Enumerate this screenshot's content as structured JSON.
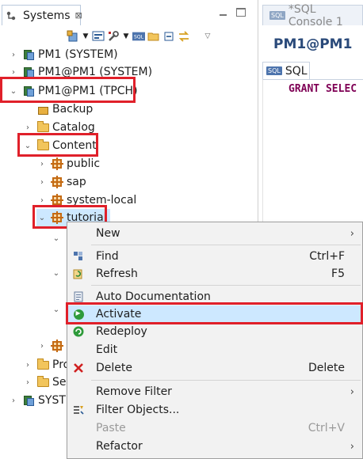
{
  "left_panel": {
    "tab_label": "Systems",
    "tab_close": "⊠"
  },
  "tree": [
    {
      "label": "PM1 (SYSTEM)",
      "twisty": "›",
      "icon": "database-icon"
    },
    {
      "label": "PM1@PM1 (SYSTEM)",
      "twisty": "›",
      "icon": "database-icon"
    },
    {
      "label": "PM1@PM1 (TPCH)",
      "twisty": "⌄",
      "icon": "database-icon"
    },
    {
      "label": "Backup",
      "twisty": "",
      "icon": "backup-icon"
    },
    {
      "label": "Catalog",
      "twisty": "›",
      "icon": "folder-icon"
    },
    {
      "label": "Content",
      "twisty": "⌄",
      "icon": "folder-icon"
    },
    {
      "label": "public",
      "twisty": "›",
      "icon": "package-icon"
    },
    {
      "label": "sap",
      "twisty": "›",
      "icon": "package-icon"
    },
    {
      "label": "system-local",
      "twisty": "›",
      "icon": "package-icon"
    },
    {
      "label": "tutorial",
      "twisty": "⌄",
      "icon": "package-icon"
    },
    {
      "label": "Pro",
      "twisty": "›",
      "icon": "folder-icon"
    },
    {
      "label": "Sec",
      "twisty": "›",
      "icon": "folder-icon"
    },
    {
      "label": "SYSTE",
      "twisty": "›",
      "icon": "database-icon"
    }
  ],
  "right_panel": {
    "editor_tab": "*SQL Console 1",
    "sql_badge": "SQL",
    "connection_title": "PM1@PM1",
    "subtab_label": "SQL",
    "editor_line": "GRANT SELEC"
  },
  "context_menu": [
    {
      "label": "New",
      "shortcut": "",
      "submenu": true,
      "icon": "",
      "disabled": false
    },
    {
      "label": "Find",
      "shortcut": "Ctrl+F",
      "submenu": false,
      "icon": "find-icon",
      "disabled": false
    },
    {
      "label": "Refresh",
      "shortcut": "F5",
      "submenu": false,
      "icon": "refresh-icon",
      "disabled": false
    },
    {
      "label": "Auto Documentation",
      "shortcut": "",
      "submenu": false,
      "icon": "document-icon",
      "disabled": false
    },
    {
      "label": "Activate",
      "shortcut": "",
      "submenu": false,
      "icon": "activate-icon",
      "disabled": false
    },
    {
      "label": "Redeploy",
      "shortcut": "",
      "submenu": false,
      "icon": "redeploy-icon",
      "disabled": false
    },
    {
      "label": "Edit",
      "shortcut": "",
      "submenu": false,
      "icon": "",
      "disabled": false
    },
    {
      "label": "Delete",
      "shortcut": "Delete",
      "submenu": false,
      "icon": "delete-icon",
      "disabled": false
    },
    {
      "label": "Remove Filter",
      "shortcut": "",
      "submenu": true,
      "icon": "",
      "disabled": false
    },
    {
      "label": "Filter Objects...",
      "shortcut": "",
      "submenu": false,
      "icon": "filter-icon",
      "disabled": false
    },
    {
      "label": "Paste",
      "shortcut": "Ctrl+V",
      "submenu": false,
      "icon": "",
      "disabled": true
    },
    {
      "label": "Refactor",
      "shortcut": "",
      "submenu": true,
      "icon": "",
      "disabled": false
    }
  ],
  "colors": {
    "highlight_box": "#e0202a",
    "menu_highlight": "#cde8ff",
    "keyword": "#7f0055"
  }
}
